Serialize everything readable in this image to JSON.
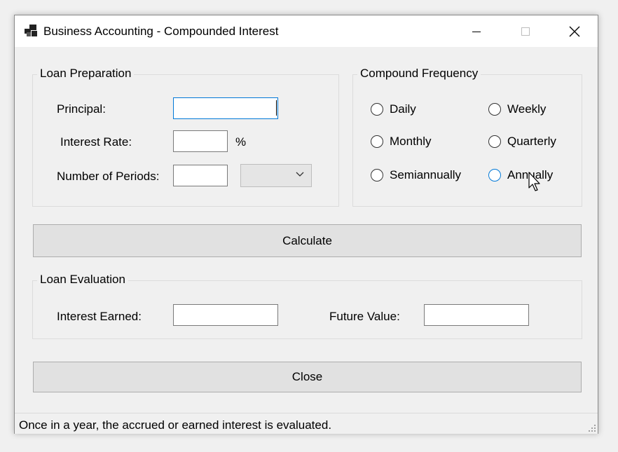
{
  "window": {
    "title": "Business Accounting - Compounded Interest"
  },
  "loan_preparation": {
    "group_title": "Loan Preparation",
    "principal_label": "Principal:",
    "principal_value": "",
    "interest_rate_label": "Interest Rate:",
    "interest_rate_value": "",
    "percent_symbol": "%",
    "periods_label": "Number of Periods:",
    "periods_value": "",
    "period_unit_selected": ""
  },
  "compound_frequency": {
    "group_title": "Compound Frequency",
    "options": [
      {
        "label": "Daily",
        "checked": false
      },
      {
        "label": "Weekly",
        "checked": false
      },
      {
        "label": "Monthly",
        "checked": false
      },
      {
        "label": "Quarterly",
        "checked": false
      },
      {
        "label": "Semiannually",
        "checked": false
      },
      {
        "label": "Annually",
        "checked": false
      }
    ]
  },
  "calculate_button": "Calculate",
  "loan_evaluation": {
    "group_title": "Loan Evaluation",
    "interest_earned_label": "Interest Earned:",
    "interest_earned_value": "",
    "future_value_label": "Future Value:",
    "future_value_value": ""
  },
  "close_button": "Close",
  "status": {
    "text": "Once in a year, the accrued or earned interest is evaluated."
  },
  "colors": {
    "focus_accent": "#0078d7",
    "button_face": "#e1e1e1",
    "window_bg": "#f0f0f0"
  }
}
